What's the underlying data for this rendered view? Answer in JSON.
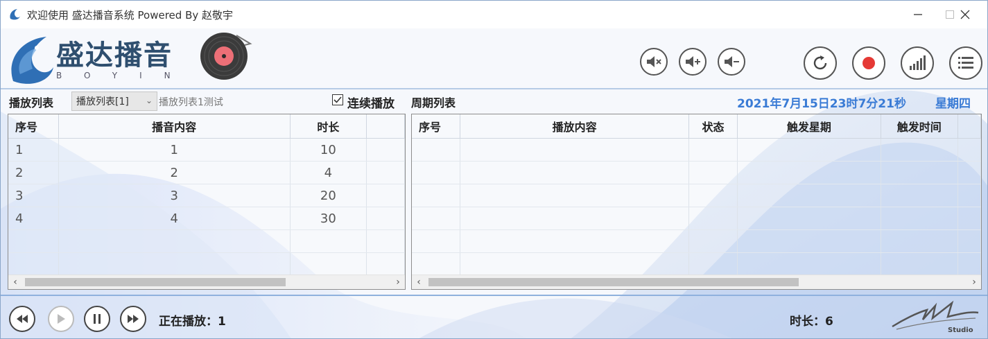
{
  "window": {
    "title": "欢迎使用   盛达播音系统    Powered By 赵敬宇"
  },
  "brand": {
    "name": "盛达播音",
    "sub": "BOYIN"
  },
  "toolbar": {
    "mute_icon": "speaker-mute-icon",
    "vol_up_icon": "speaker-plus-icon",
    "vol_down_icon": "speaker-minus-icon",
    "refresh_icon": "refresh-icon",
    "record_icon": "record-icon",
    "signal_icon": "signal-bars-icon",
    "list_icon": "list-icon"
  },
  "playlist": {
    "label": "播放列表",
    "selected": "播放列表[1]",
    "name": "播放列表1测试",
    "continuous_label": "连续播放",
    "continuous_checked": true,
    "columns": [
      "序号",
      "播音内容",
      "时长"
    ],
    "rows": [
      [
        "1",
        "1",
        "10"
      ],
      [
        "2",
        "2",
        "4"
      ],
      [
        "3",
        "3",
        "20"
      ],
      [
        "4",
        "4",
        "30"
      ]
    ]
  },
  "schedule": {
    "label": "周期列表",
    "datetime": "2021年7月15日23时7分21秒",
    "weekday": "星期四",
    "columns": [
      "序号",
      "播放内容",
      "状态",
      "触发星期",
      "触发时间"
    ]
  },
  "footer": {
    "now_playing": "正在播放：1",
    "duration": "时长：6",
    "studio": "Studio"
  },
  "colors": {
    "accent": "#3a7bd5",
    "record": "#e53935"
  }
}
